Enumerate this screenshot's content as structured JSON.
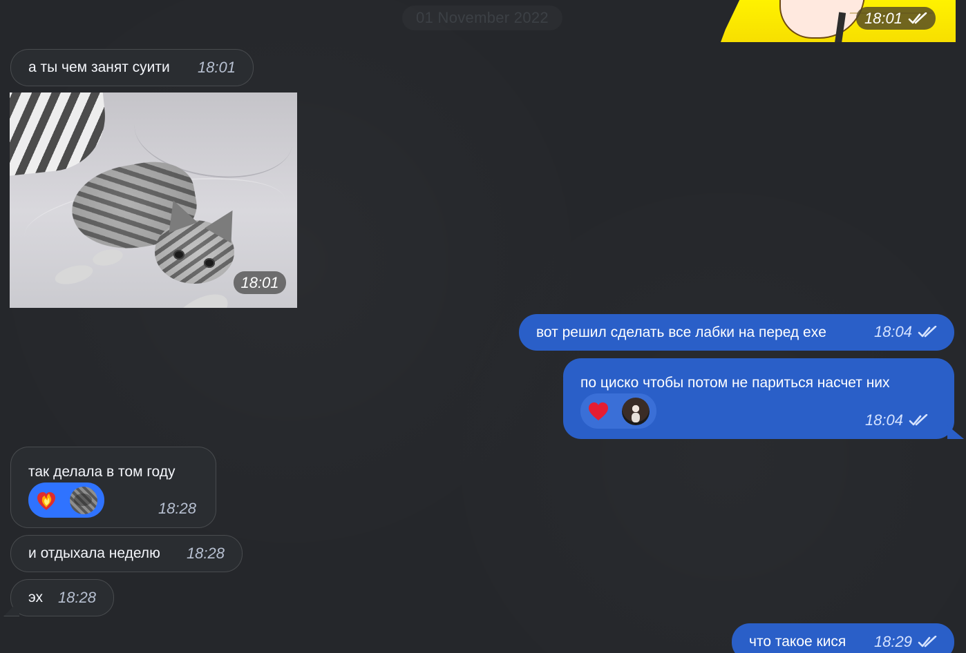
{
  "chat": {
    "date": "01 November 2022",
    "sticker": {
      "time": "18:01"
    },
    "messages": [
      {
        "text": "а ты чем занят суити",
        "time": "18:01"
      },
      {
        "photo_time": "18:01"
      },
      {
        "text": "вот решил сделать все лабки на перед exe",
        "time": "18:04"
      },
      {
        "text": "по циско чтобы потом не париться насчет них",
        "time": "18:04",
        "reaction": "heart-icon"
      },
      {
        "text": "так делала в том году",
        "time": "18:28",
        "reaction": "fire-heart-icon"
      },
      {
        "text": "и отдыхала неделю",
        "time": "18:28"
      },
      {
        "text": "эх",
        "time": "18:28"
      },
      {
        "text": "что такое кися",
        "time": "18:29"
      }
    ]
  },
  "colors": {
    "background": "#25272b",
    "incoming_bubble": "#2a2d31",
    "outgoing_bubble": "#2a5fc8",
    "reaction_blue": "#2f73ff",
    "sticker_yellow": "#fff200"
  }
}
